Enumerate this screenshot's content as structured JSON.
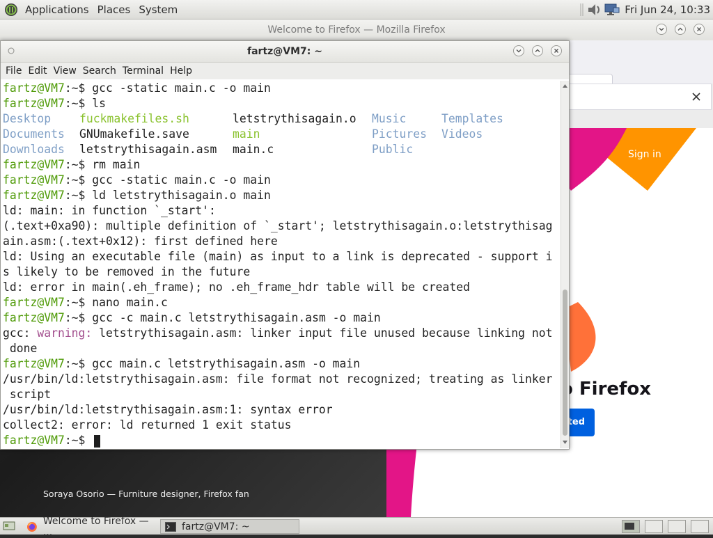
{
  "top_panel": {
    "menus": [
      "Applications",
      "Places",
      "System"
    ],
    "clock": "Fri Jun 24, 10:33",
    "icons": [
      "mate-menu-icon",
      "volume-icon",
      "network-icon"
    ]
  },
  "firefox": {
    "window_title": "Welcome to Firefox — Mozilla Firefox",
    "signin": "Sign in",
    "welcome_partial": "o Firefox",
    "button_partial": "ted",
    "caption": "Soraya Osorio — Furniture designer, Firefox fan",
    "colors": {
      "accent": "#0060df",
      "hero_pink": "#e31587",
      "hero_orange": "#ff9400"
    }
  },
  "terminal": {
    "title": "fartz@VM7: ~",
    "menu": [
      "File",
      "Edit",
      "View",
      "Search",
      "Terminal",
      "Help"
    ],
    "prompt": "fartz@VM7",
    "prompt_suffix": ":~$ ",
    "commands": {
      "c1": "gcc -static main.c -o main",
      "c2": "ls",
      "c3": "rm main",
      "c4": "gcc -static main.c -o main",
      "c5": "ld letstrythisagain.o main",
      "c6": "nano main.c",
      "c7": "gcc -c main.c letstrythisagain.asm -o main",
      "c8": "gcc main.c letstrythisagain.asm -o main"
    },
    "ls_rows": [
      [
        "Desktop",
        "fuckmakefiles.sh",
        "letstrythisagain.o",
        "Music",
        "Templates"
      ],
      [
        "Documents",
        "GNUmakefile.save",
        "main",
        "Pictures",
        "Videos"
      ],
      [
        "Downloads",
        "letstrythisagain.asm",
        "main.c",
        "Public",
        ""
      ]
    ],
    "output": {
      "o1": "ld: main: in function `_start':",
      "o2": "(.text+0xa90): multiple definition of `_start'; letstrythisagain.o:letstrythisag",
      "o3": "ain.asm:(.text+0x12): first defined here",
      "o4": "ld: Using an executable file (main) as input to a link is deprecated - support i",
      "o5": "s likely to be removed in the future",
      "o6": "ld: error in main(.eh_frame); no .eh_frame_hdr table will be created",
      "o7_prefix": "gcc: ",
      "o7_warn": "warning:",
      "o7_rest": " letstrythisagain.asm: linker input file unused because linking not",
      "o8": " done",
      "o9": "/usr/bin/ld:letstrythisagain.asm: file format not recognized; treating as linker",
      "o10": " script",
      "o11": "/usr/bin/ld:letstrythisagain.asm:1: syntax error",
      "o12": "collect2: error: ld returned 1 exit status"
    }
  },
  "bottom_panel": {
    "tasks": [
      "Welcome to Firefox — ...",
      "fartz@VM7: ~"
    ]
  }
}
